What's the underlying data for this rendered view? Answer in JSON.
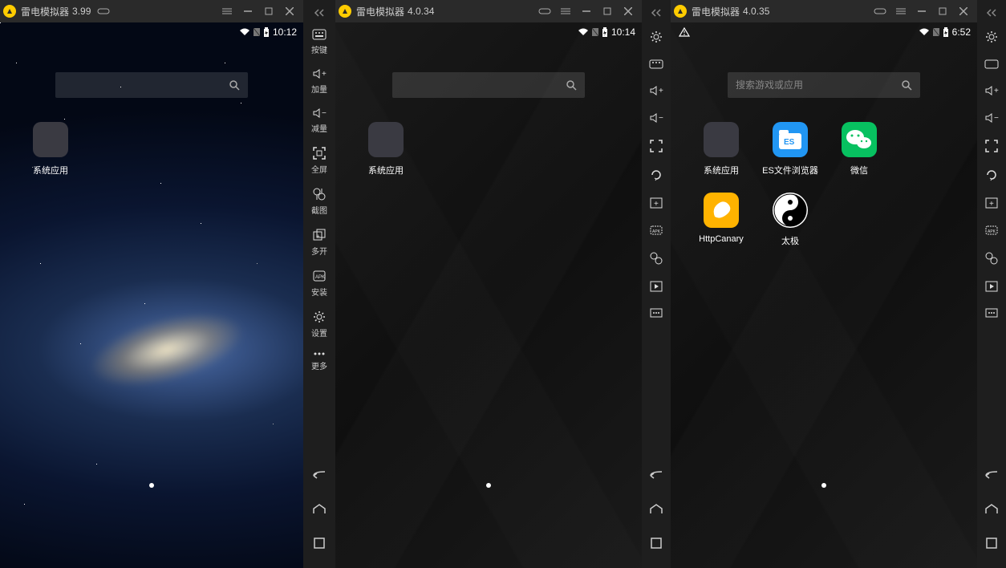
{
  "instances": [
    {
      "title": "雷电模拟器",
      "version": "3.99",
      "time": "10:12",
      "search_placeholder": "",
      "apps": [
        {
          "name": "sysapp",
          "label": "系统应用"
        }
      ],
      "sidebar": {
        "mode": "labeled",
        "items": [
          {
            "key": "keys",
            "label": "按键"
          },
          {
            "key": "volup",
            "label": "加量"
          },
          {
            "key": "voldown",
            "label": "减量"
          },
          {
            "key": "fullscreen",
            "label": "全屏"
          },
          {
            "key": "screenshot",
            "label": "截图"
          },
          {
            "key": "multi",
            "label": "多开"
          },
          {
            "key": "install",
            "label": "安装"
          },
          {
            "key": "settings",
            "label": "设置"
          },
          {
            "key": "more",
            "label": "更多"
          }
        ]
      }
    },
    {
      "title": "雷电模拟器",
      "version": "4.0.34",
      "time": "10:14",
      "search_placeholder": "",
      "apps": [
        {
          "name": "sysapp",
          "label": "系统应用"
        }
      ],
      "sidebar": {
        "mode": "icons"
      }
    },
    {
      "title": "雷电模拟器",
      "version": "4.0.35",
      "time": "6:52",
      "search_placeholder": "搜索游戏或应用",
      "warning": true,
      "apps": [
        {
          "name": "sysapp",
          "label": "系统应用"
        },
        {
          "name": "es",
          "label": "ES文件浏览器"
        },
        {
          "name": "wechat",
          "label": "微信"
        },
        {
          "name": "canary",
          "label": "HttpCanary"
        },
        {
          "name": "taiji",
          "label": "太极"
        }
      ],
      "sidebar": {
        "mode": "icons"
      }
    }
  ],
  "icon_sidebar_keys": [
    "settings",
    "keys",
    "volup",
    "voldown",
    "fullscreen",
    "rotate",
    "addwin",
    "apk",
    "screenshot",
    "play",
    "more"
  ]
}
